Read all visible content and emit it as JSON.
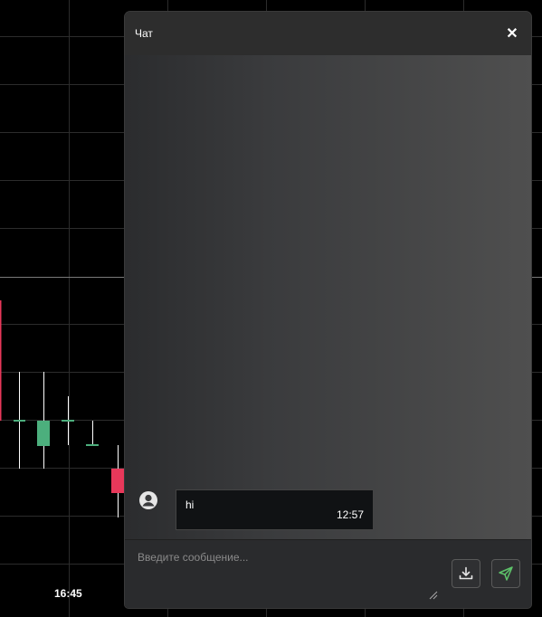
{
  "chart": {
    "time_label": "16:45",
    "candle_up_color": "#4caf7d",
    "candle_down_color": "#e8385a"
  },
  "chat": {
    "title": "Чат",
    "close_icon": "close-icon",
    "messages": [
      {
        "text": "hi",
        "time": "12:57",
        "avatar_icon": "user-avatar-icon"
      }
    ],
    "composer": {
      "placeholder": "Введите сообщение...",
      "download_icon": "download-icon",
      "send_icon": "send-icon",
      "send_icon_color": "#5ec36a"
    }
  }
}
